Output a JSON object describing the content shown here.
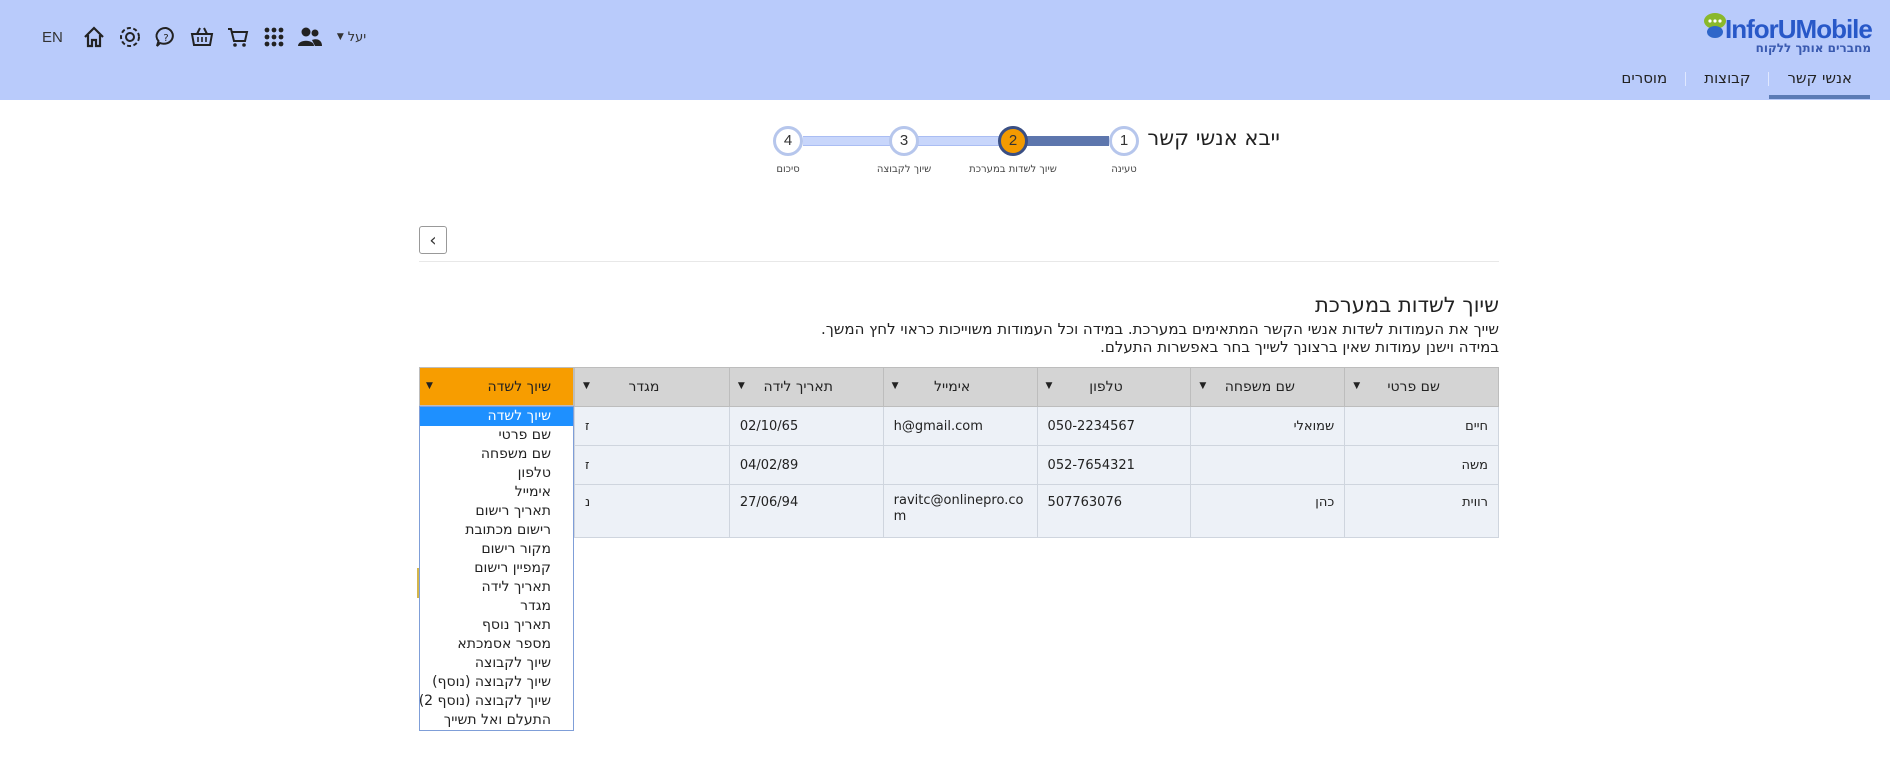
{
  "header": {
    "logo_text": "InforUMobile",
    "logo_tagline": "מחברים אותך ללקוח",
    "nav_tabs": [
      {
        "label": "אנשי קשר",
        "active": true
      },
      {
        "label": "קבוצות",
        "active": false
      },
      {
        "label": "מוסרים",
        "active": false
      }
    ],
    "user_name": "יעל",
    "language": "EN",
    "icons": [
      "home-icon",
      "gear-icon",
      "help-chat-icon",
      "basket-icon",
      "cart-icon",
      "apps-grid-icon",
      "users-icon"
    ]
  },
  "page": {
    "title": "ייבא אנשי קשר"
  },
  "stepper": {
    "steps": [
      {
        "number": "1",
        "label": "טעינה",
        "state": "done"
      },
      {
        "number": "2",
        "label": "שיוך לשדות במערכת",
        "state": "active"
      },
      {
        "number": "3",
        "label": "שיוך לקבוצה",
        "state": "pending"
      },
      {
        "number": "4",
        "label": "סיכום",
        "state": "pending"
      }
    ]
  },
  "back_button": {
    "label": "‹"
  },
  "section": {
    "title": "שיוך לשדות במערכת",
    "line1": "שייך את העמודות לשדות אנשי הקשר המתאימים במערכת. במידה וכל העמודות משוייכות כראוי לחץ המשך.",
    "line2": "במידה וישנן עמודות שאין ברצונך לשייך בחר באפשרות התעלם."
  },
  "table": {
    "columns": [
      "שם פרטי",
      "שם משפחה",
      "טלפון",
      "אימייל",
      "תאריך לידה",
      "מגדר"
    ],
    "rows": [
      [
        "חיים",
        "שמואלי",
        "050-2234567",
        "h@gmail.com",
        "02/10/65",
        "ז"
      ],
      [
        "משה",
        "",
        "052-7654321",
        "",
        "04/02/89",
        "ז"
      ],
      [
        "רווית",
        "כהן",
        "507763076",
        "ravitc@onlinepro.com",
        "27/06/94",
        "נ"
      ]
    ]
  },
  "mapping_column": {
    "header_label": "שיוך לשדה",
    "options": [
      "שיוך לשדה",
      "שם פרטי",
      "שם משפחה",
      "טלפון",
      "אימייל",
      "תאריך רישום",
      "רישום מכתובת",
      "מקור רישום",
      "קמפיין רישום",
      "תאריך לידה",
      "מגדר",
      "תאריך נוסף",
      "מספר אסמכתא",
      "שיוך לקבוצה",
      "שיוך לקבוצה (נוסף)",
      "שיוך לקבוצה (נוסף 2)",
      "התעלם ואל תשייך"
    ],
    "selected_index": 0
  },
  "colors": {
    "header_bg": "#b9cbfb",
    "accent_orange": "#f79d00",
    "step_done": "#5d76ad",
    "selected_option": "#1e90ff"
  }
}
